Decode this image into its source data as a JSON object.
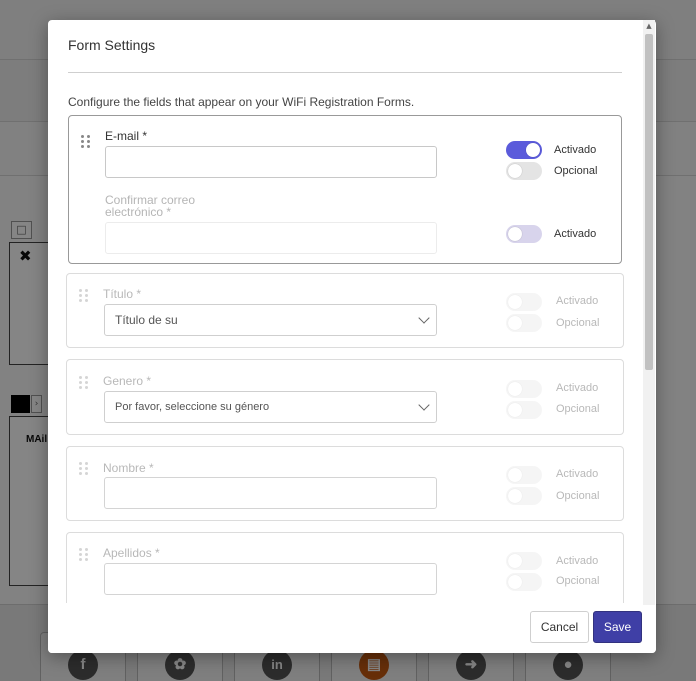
{
  "modal": {
    "title": "Form Settings",
    "description": "Configure the fields that appear on your WiFi Registration Forms.",
    "cancel_label": "Cancel",
    "save_label": "Save"
  },
  "fields": [
    {
      "label": "E-mail *",
      "enabled_label": "Activado",
      "optional_label": "Opcional",
      "enabled": true,
      "optional": false
    },
    {
      "label": "Confirmar correo electrónico *",
      "enabled_label": "Activado",
      "enabled": false
    },
    {
      "label": "Título *",
      "select_value": "Título de su",
      "enabled_label": "Activado",
      "optional_label": "Opcional",
      "enabled": false,
      "optional": false
    },
    {
      "label": "Genero *",
      "select_value": "Por favor, seleccione su género",
      "enabled_label": "Activado",
      "optional_label": "Opcional",
      "enabled": false,
      "optional": false
    },
    {
      "label": "Nombre *",
      "enabled_label": "Activado",
      "optional_label": "Opcional",
      "enabled": false,
      "optional": false
    },
    {
      "label": "Apellidos *",
      "enabled_label": "Activado",
      "optional_label": "Opcional",
      "enabled": false,
      "optional": false
    }
  ],
  "background": {
    "label": "MAil"
  },
  "colors": {
    "toggle_on": "#5b5bdb",
    "save_button": "#3f3fa6",
    "overlay": "rgba(0,0,0,0.48)"
  }
}
